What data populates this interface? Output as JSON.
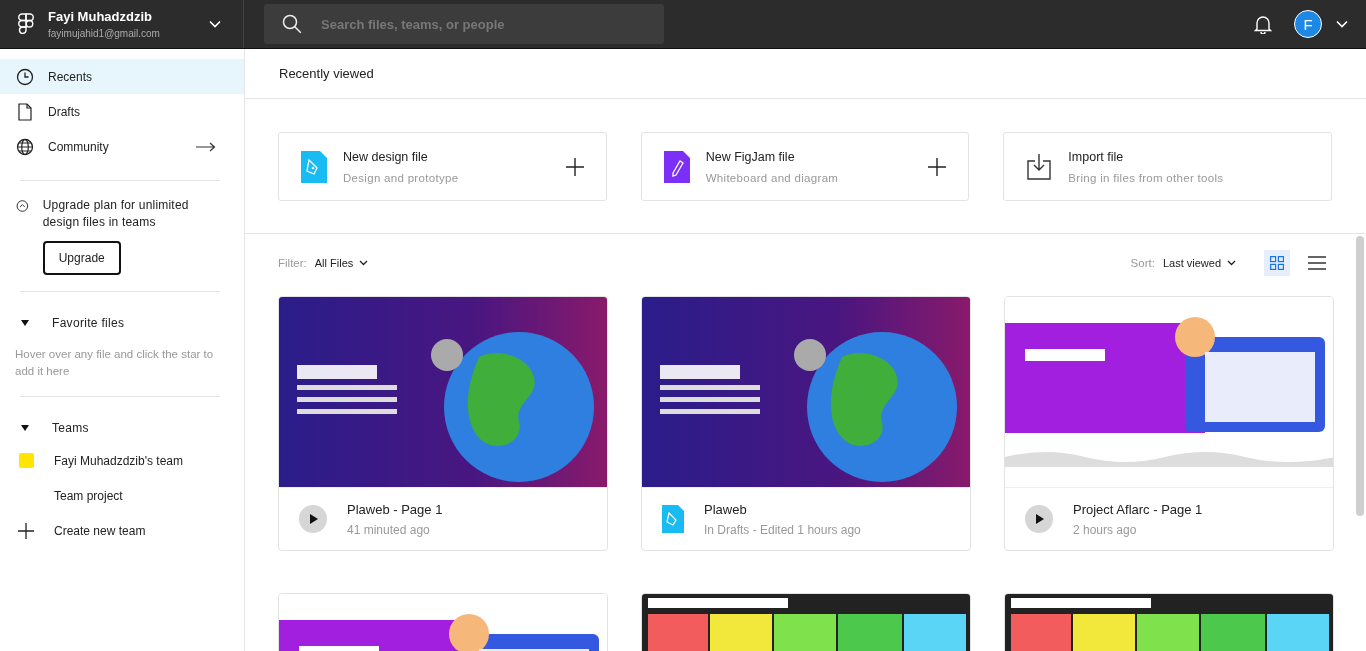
{
  "account": {
    "name": "Fayi Muhadzdzib",
    "email": "fayimujahid1@gmail.com"
  },
  "search": {
    "placeholder": "Search files, teams, or people"
  },
  "profile": {
    "initial": "F"
  },
  "sidebar": {
    "nav": [
      {
        "label": "Recents",
        "kind": "clock",
        "selected": true,
        "arrow": false
      },
      {
        "label": "Drafts",
        "kind": "file",
        "selected": false,
        "arrow": false
      },
      {
        "label": "Community",
        "kind": "globe",
        "selected": false,
        "arrow": true
      }
    ],
    "upgrade": {
      "text": "Upgrade plan for unlimited design files in teams",
      "button": "Upgrade"
    },
    "favorites": {
      "title": "Favorite files",
      "expanded": true,
      "hint": "Hover over any file and click the star to add it here"
    },
    "teams": {
      "title": "Teams",
      "expanded": true,
      "items": [
        {
          "label": "Fayi Muhadzdzib's team",
          "kind": "team",
          "color": "#ffe500"
        },
        {
          "label": "Team project",
          "kind": "project"
        },
        {
          "label": "Create new team",
          "kind": "create"
        }
      ]
    }
  },
  "header": {
    "title": "Recently viewed"
  },
  "actions": [
    {
      "title": "New design file",
      "subtitle": "Design and prototype",
      "kind": "design",
      "plus": true
    },
    {
      "title": "New FigJam file",
      "subtitle": "Whiteboard and diagram",
      "kind": "figjam",
      "plus": true
    },
    {
      "title": "Import file",
      "subtitle": "Bring in files from other tools",
      "kind": "import",
      "plus": false
    }
  ],
  "filter": {
    "label": "Filter:",
    "value": "All Files"
  },
  "sort": {
    "label": "Sort:",
    "value": "Last viewed"
  },
  "view": [
    {
      "kind": "grid",
      "selected": true
    },
    {
      "kind": "list",
      "selected": false
    }
  ],
  "files": [
    {
      "kind": "space",
      "prototype": true,
      "title": "Plaweb - Page 1",
      "subtitle": "41 minuted ago"
    },
    {
      "kind": "space",
      "prototype": false,
      "title": "Plaweb",
      "subtitle": "In Drafts - Edited 1 hours ago"
    },
    {
      "kind": "landing",
      "prototype": true,
      "title": "Project Aflarc - Page 1",
      "subtitle": "2 hours ago"
    },
    {
      "kind": "landing"
    },
    {
      "kind": "canvas"
    },
    {
      "kind": "canvas"
    }
  ]
}
